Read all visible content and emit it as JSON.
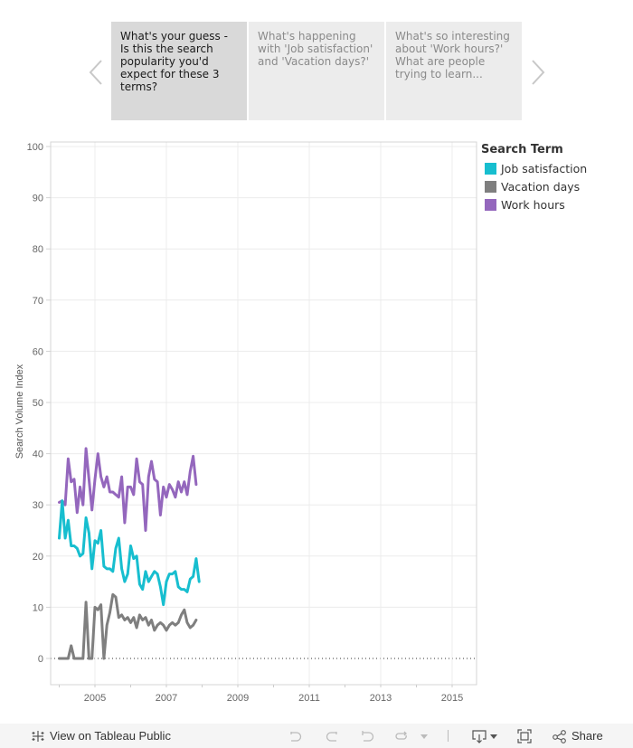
{
  "story": {
    "points": [
      {
        "label": "What's your guess  - Is this the search popularity you'd expect for these 3 terms?",
        "active": true
      },
      {
        "label": "What's happening with 'Job satisfaction' and 'Vacation days?'",
        "active": false
      },
      {
        "label": "What's so interesting about 'Work hours?' What are people trying to learn...",
        "active": false
      }
    ],
    "prev_icon": "chevron-left-icon",
    "next_icon": "chevron-right-icon"
  },
  "legend": {
    "title": "Search Term",
    "items": [
      {
        "label": "Job satisfaction",
        "color": "#17becf"
      },
      {
        "label": "Vacation days",
        "color": "#7f7f7f"
      },
      {
        "label": "Work hours",
        "color": "#9467bd"
      }
    ]
  },
  "toolbar": {
    "view_label": "View on Tableau Public",
    "share_label": "Share",
    "icons": [
      "tableau-logo-icon",
      "undo-icon",
      "redo-icon",
      "revert-icon",
      "refresh-icon",
      "pause-dropdown-icon",
      "download-icon",
      "fullscreen-icon",
      "share-icon"
    ]
  },
  "chart_data": {
    "type": "line",
    "title": "",
    "xlabel": "",
    "ylabel": "Search Volume Index",
    "xlim": [
      2003.76,
      2015.68
    ],
    "ylim": [
      -5,
      101
    ],
    "yticks": [
      0,
      10,
      20,
      30,
      40,
      50,
      60,
      70,
      80,
      90,
      100
    ],
    "xticks": [
      2005,
      2007,
      2009,
      2011,
      2013,
      2015
    ],
    "grid": true,
    "zero_line": "dotted",
    "legend_position": "right",
    "x_start": 2004.0,
    "x_step_months": 1,
    "series": [
      {
        "name": "Work hours",
        "color": "#9467bd",
        "values": [
          30.5,
          30.8,
          30,
          39,
          34.5,
          35,
          28.5,
          33.5,
          30,
          41,
          35,
          29,
          35,
          40,
          35.5,
          33.5,
          35.5,
          32.5,
          32.5,
          32,
          31.5,
          35.5,
          26.5,
          33.5,
          33.5,
          32,
          39,
          34.5,
          34,
          25,
          35.5,
          38.5,
          35,
          34.5,
          28,
          33.5,
          31.5,
          34,
          33,
          31.5,
          34.5,
          32.5,
          34.5,
          32,
          36.5,
          39.5,
          34
        ]
      },
      {
        "name": "Job satisfaction",
        "color": "#17becf",
        "values": [
          23.5,
          30.8,
          23.5,
          27,
          22,
          22,
          21.5,
          20,
          20.5,
          27.5,
          24.5,
          17.5,
          23,
          22.5,
          25,
          18,
          17.5,
          17.5,
          17,
          21.5,
          23.5,
          17.5,
          15,
          16.5,
          22,
          19.5,
          20,
          14.5,
          13.5,
          17,
          15,
          16,
          17,
          16.5,
          14,
          10.5,
          15,
          16.5,
          16.5,
          17,
          14,
          13.5,
          13.5,
          13,
          15.5,
          16,
          19.5,
          15
        ]
      },
      {
        "name": "Vacation days",
        "color": "#7f7f7f",
        "values": [
          0,
          0,
          0,
          0,
          2.5,
          0,
          0,
          0,
          0,
          11,
          0,
          0,
          10,
          9.5,
          10.5,
          0,
          6.5,
          9,
          12.5,
          12,
          8,
          8.5,
          7.5,
          8,
          7,
          8,
          6,
          8.5,
          7.5,
          8,
          6.5,
          7.5,
          5.5,
          6.5,
          7,
          6.5,
          5.5,
          6.5,
          7,
          6.5,
          7,
          8.5,
          9.5,
          7,
          6,
          6.5,
          7.5
        ]
      }
    ]
  }
}
